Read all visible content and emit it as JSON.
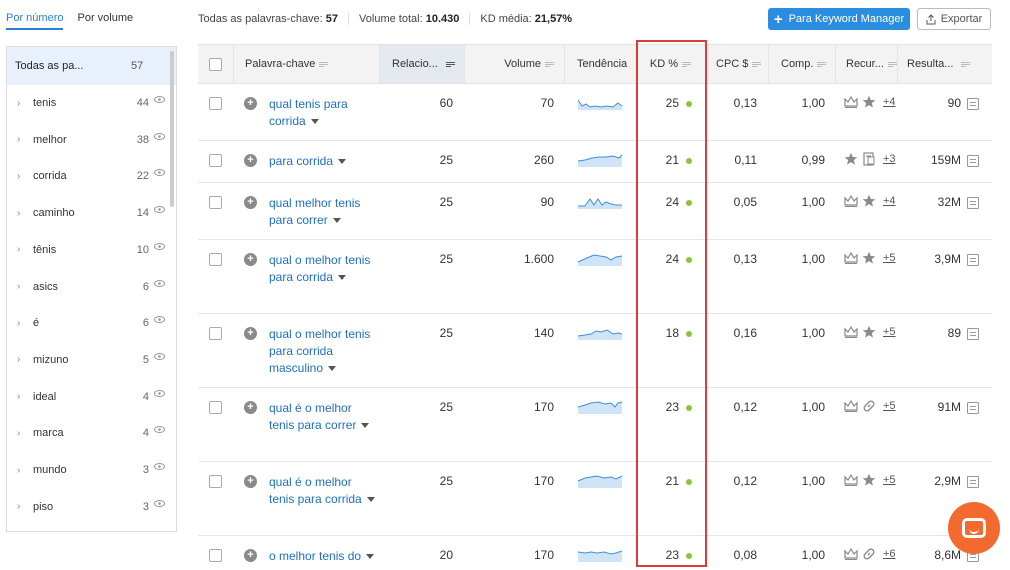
{
  "tabs": [
    "Por número",
    "Por volume"
  ],
  "stats": {
    "all_label": "Todas as palavras-chave:",
    "all_value": "57",
    "vol_label": "Volume total:",
    "vol_value": "10.430",
    "kd_label": "KD média:",
    "kd_value": "21,57%"
  },
  "buttons": {
    "keyword_manager": "Para Keyword Manager",
    "export": "Exportar"
  },
  "sidebar": {
    "all_label": "Todas as pa...",
    "all_count": "57",
    "items": [
      {
        "label": "tenis",
        "count": "44"
      },
      {
        "label": "melhor",
        "count": "38"
      },
      {
        "label": "corrida",
        "count": "22"
      },
      {
        "label": "caminho",
        "count": "14"
      },
      {
        "label": "tênis",
        "count": "10"
      },
      {
        "label": "asics",
        "count": "6"
      },
      {
        "label": "é",
        "count": "6"
      },
      {
        "label": "mizuno",
        "count": "5"
      },
      {
        "label": "ideal",
        "count": "4"
      },
      {
        "label": "marca",
        "count": "4"
      },
      {
        "label": "mundo",
        "count": "3"
      },
      {
        "label": "piso",
        "count": "3"
      }
    ]
  },
  "columns": [
    "Palavra-chave",
    "Relacio...",
    "Volume",
    "Tendência",
    "KD %",
    "CPC $",
    "Comp.",
    "Recur...",
    "Resulta..."
  ],
  "rows": [
    {
      "keyword": "qual tenis para corrida",
      "rel": "60",
      "volume": "70",
      "kd": "25",
      "cpc": "0,13",
      "comp": "1,00",
      "features": [
        "crown-icon",
        "star-icon"
      ],
      "more": "+4",
      "results": "90"
    },
    {
      "keyword": "para corrida",
      "rel": "25",
      "volume": "260",
      "kd": "21",
      "cpc": "0,11",
      "comp": "0,99",
      "features": [
        "star-icon",
        "doc-icon"
      ],
      "more": "+3",
      "results": "159M"
    },
    {
      "keyword": "qual melhor tenis para correr",
      "rel": "25",
      "volume": "90",
      "kd": "24",
      "cpc": "0,05",
      "comp": "1,00",
      "features": [
        "crown-icon",
        "star-icon"
      ],
      "more": "+4",
      "results": "32M"
    },
    {
      "keyword": "qual o melhor tenis para corrida",
      "rel": "25",
      "volume": "1.600",
      "kd": "24",
      "cpc": "0,13",
      "comp": "1,00",
      "features": [
        "crown-icon",
        "star-icon"
      ],
      "more": "+5",
      "results": "3,9M"
    },
    {
      "keyword": "qual o melhor tenis para corrida masculino",
      "rel": "25",
      "volume": "140",
      "kd": "18",
      "cpc": "0,16",
      "comp": "1,00",
      "features": [
        "crown-icon",
        "star-icon"
      ],
      "more": "+5",
      "results": "89"
    },
    {
      "keyword": "qual é o melhor tenis para correr",
      "rel": "25",
      "volume": "170",
      "kd": "23",
      "cpc": "0,12",
      "comp": "1,00",
      "features": [
        "crown-icon",
        "link-icon"
      ],
      "more": "+5",
      "results": "91M"
    },
    {
      "keyword": "qual é o melhor tenis para corrida",
      "rel": "25",
      "volume": "170",
      "kd": "21",
      "cpc": "0,12",
      "comp": "1,00",
      "features": [
        "crown-icon",
        "star-icon"
      ],
      "more": "+5",
      "results": "2,9M"
    },
    {
      "keyword": "o melhor tenis do",
      "rel": "20",
      "volume": "170",
      "kd": "23",
      "cpc": "0,08",
      "comp": "1,00",
      "features": [
        "crown-icon",
        "link-icon"
      ],
      "more": "+6",
      "results": "8,6M"
    }
  ],
  "colors": {
    "accent": "#2a8de0",
    "link": "#1e6fc0",
    "kd_dot": "#8ac43f",
    "highlight": "#e03a3a",
    "chat": "#f26a2e"
  }
}
